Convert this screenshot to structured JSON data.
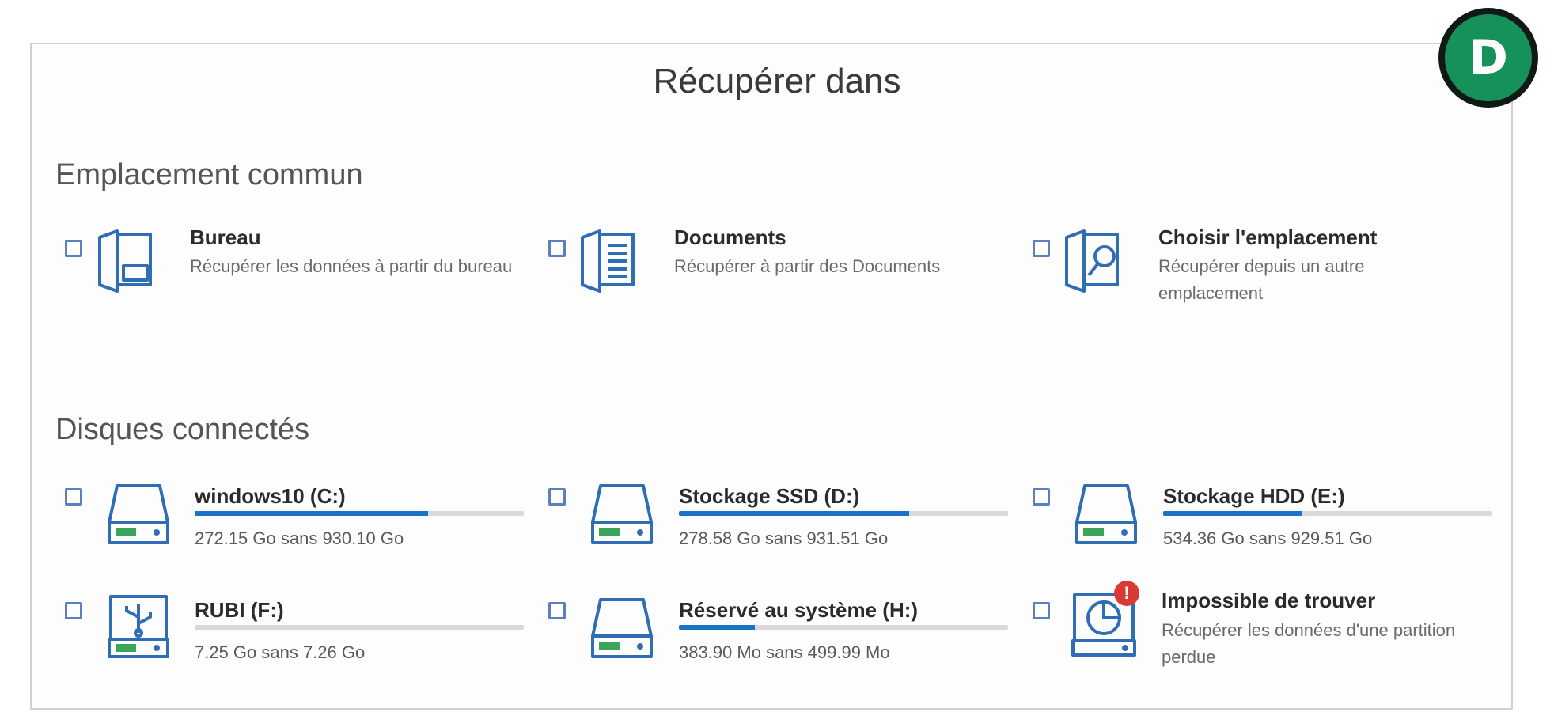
{
  "dialog": {
    "title": "Récupérer dans",
    "badge_letter": "D"
  },
  "common": {
    "heading": "Emplacement commun",
    "items": [
      {
        "name": "Bureau",
        "desc": "Récupérer les données à partir du bureau",
        "icon": "desktop-folder-icon"
      },
      {
        "name": "Documents",
        "desc": "Récupérer à partir des Documents",
        "icon": "documents-folder-icon"
      },
      {
        "name": "Choisir l'emplacement",
        "desc": "Récupérer depuis un autre emplacement",
        "icon": "folder-search-icon"
      }
    ]
  },
  "disks": {
    "heading": "Disques connectés",
    "items": [
      {
        "name": "windows10 (C:)",
        "size": "272.15 Go sans 930.10 Go",
        "usage": 0.71,
        "icon": "hard-drive-icon"
      },
      {
        "name": "Stockage SSD (D:)",
        "size": "278.58 Go sans 931.51 Go",
        "usage": 0.7,
        "icon": "hard-drive-icon"
      },
      {
        "name": "Stockage HDD (E:)",
        "size": "534.36 Go sans 929.51 Go",
        "usage": 0.42,
        "icon": "hard-drive-icon"
      },
      {
        "name": "RUBI (F:)",
        "size": "7.25 Go sans 7.26 Go",
        "usage": 0.0,
        "icon": "usb-drive-icon"
      },
      {
        "name": "Réservé au système (H:)",
        "size": "383.90 Mo sans 499.99 Mo",
        "usage": 0.23,
        "icon": "hard-drive-icon"
      },
      {
        "name": "Impossible de trouver",
        "desc": "Récupérer les données d'une partition perdue",
        "icon": "lost-partition-icon",
        "alert": "!"
      }
    ]
  },
  "colors": {
    "accent": "#1a73c8",
    "icon": "#2f6db5",
    "badge": "#17915a",
    "alert": "#d83a34"
  }
}
